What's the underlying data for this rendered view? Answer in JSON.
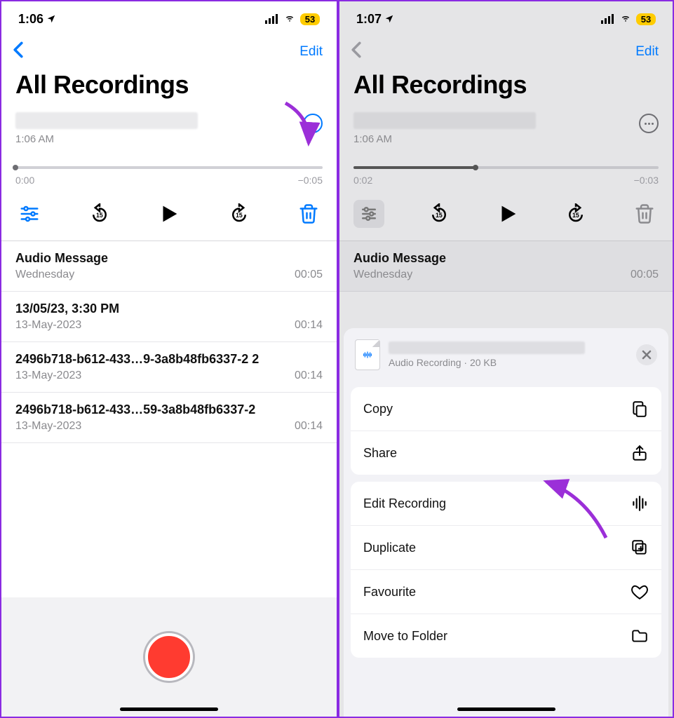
{
  "left": {
    "status": {
      "time": "1:06",
      "battery": "53"
    },
    "nav": {
      "edit": "Edit"
    },
    "title": "All Recordings",
    "current": {
      "subtitle": "1:06 AM",
      "time_elapsed": "0:00",
      "time_remaining": "−0:05",
      "progress_pct": 0
    },
    "list": [
      {
        "title": "Audio Message",
        "sub": "Wednesday",
        "dur": "00:05"
      },
      {
        "title": "13/05/23, 3:30 PM",
        "sub": "13-May-2023",
        "dur": "00:14"
      },
      {
        "title": "2496b718-b612-433…9-3a8b48fb6337-2 2",
        "sub": "13-May-2023",
        "dur": "00:14"
      },
      {
        "title": "2496b718-b612-433…59-3a8b48fb6337-2",
        "sub": "13-May-2023",
        "dur": "00:14"
      }
    ]
  },
  "right": {
    "status": {
      "time": "1:07",
      "battery": "53"
    },
    "nav": {
      "edit": "Edit"
    },
    "title": "All Recordings",
    "current": {
      "subtitle": "1:06 AM",
      "time_elapsed": "0:02",
      "time_remaining": "−0:03",
      "progress_pct": 40
    },
    "list": [
      {
        "title": "Audio Message",
        "sub": "Wednesday",
        "dur": "00:05"
      }
    ],
    "sheet": {
      "meta": "Audio Recording · 20 KB",
      "group1": [
        {
          "label": "Copy",
          "icon": "copy"
        },
        {
          "label": "Share",
          "icon": "share"
        }
      ],
      "group2": [
        {
          "label": "Edit Recording",
          "icon": "waveform"
        },
        {
          "label": "Duplicate",
          "icon": "duplicate"
        },
        {
          "label": "Favourite",
          "icon": "heart"
        },
        {
          "label": "Move to Folder",
          "icon": "folder"
        }
      ]
    }
  }
}
